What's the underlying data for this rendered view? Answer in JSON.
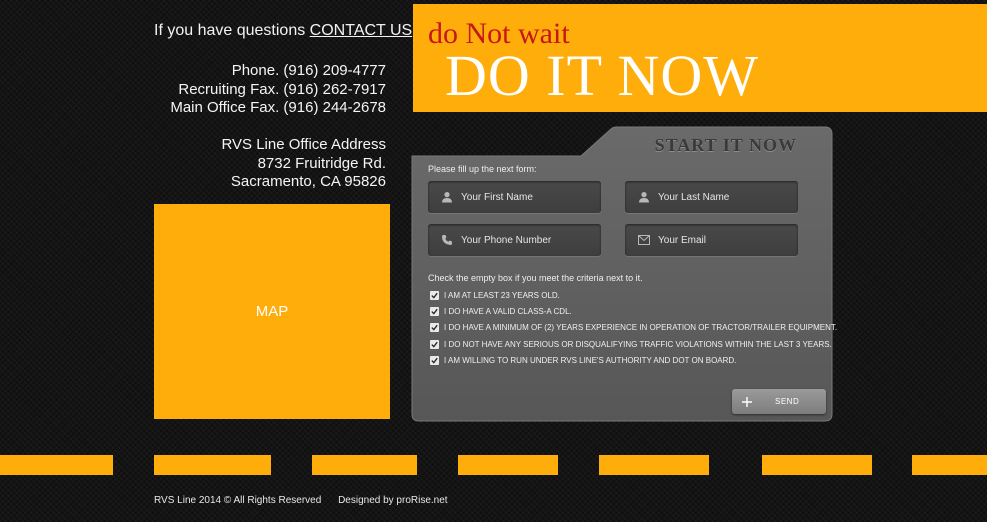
{
  "header": {
    "questions_text": "If you have questions",
    "contact_link": "CONTACT US"
  },
  "contacts": {
    "phone": "Phone. (916) 209-4777",
    "recruiting_fax": "Recruiting Fax. (916) 262-7917",
    "main_office_fax": "Main Office Fax. (916) 244-2678"
  },
  "address": {
    "title": "RVS Line Office Address",
    "street": "8732 Fruitridge Rd.",
    "city": "Sacramento, CA 95826"
  },
  "map": {
    "label": "MAP"
  },
  "banner": {
    "subtitle": "do Not wait",
    "title": "DO IT NOW"
  },
  "form": {
    "title": "START IT NOW",
    "intro": "Please fill up the next form:",
    "fields": [
      {
        "placeholder": "Your First Name",
        "icon": "user-icon"
      },
      {
        "placeholder": "Your Last Name",
        "icon": "user-icon"
      },
      {
        "placeholder": "Your Phone Number",
        "icon": "phone-icon"
      },
      {
        "placeholder": "Your Email",
        "icon": "envelope-icon"
      }
    ],
    "criteria_intro": "Check the empty box if you meet the criteria next to it.",
    "criteria": [
      {
        "label": "I AM  AT LEAST 23 YEARS OLD.",
        "checked": true
      },
      {
        "label": "I DO HAVE A VALID CLASS-A CDL.",
        "checked": true
      },
      {
        "label": "I DO HAVE A MINIMUM OF (2) YEARS EXPERIENCE IN OPERATION OF TRACTOR/TRAILER EQUIPMENT.",
        "checked": true
      },
      {
        "label": "I DO NOT HAVE ANY SERIOUS OR DISQUALIFYING TRAFFIC VIOLATIONS WITHIN THE LAST 3 YEARS.",
        "checked": true
      },
      {
        "label": "I AM WILLING TO RUN UNDER RVS LINE'S AUTHORITY AND DOT ON BOARD.",
        "checked": true
      }
    ],
    "send_label": "SEND"
  },
  "footer": {
    "copyright": "RVS Line  2014 © All Rights Reserved",
    "designed_by": "Designed  by  proRise.net"
  },
  "colors": {
    "accent_orange": "#ffad0a",
    "banner_red": "#c61818",
    "panel_gray": "#5f5f5f",
    "background": "#141414"
  }
}
